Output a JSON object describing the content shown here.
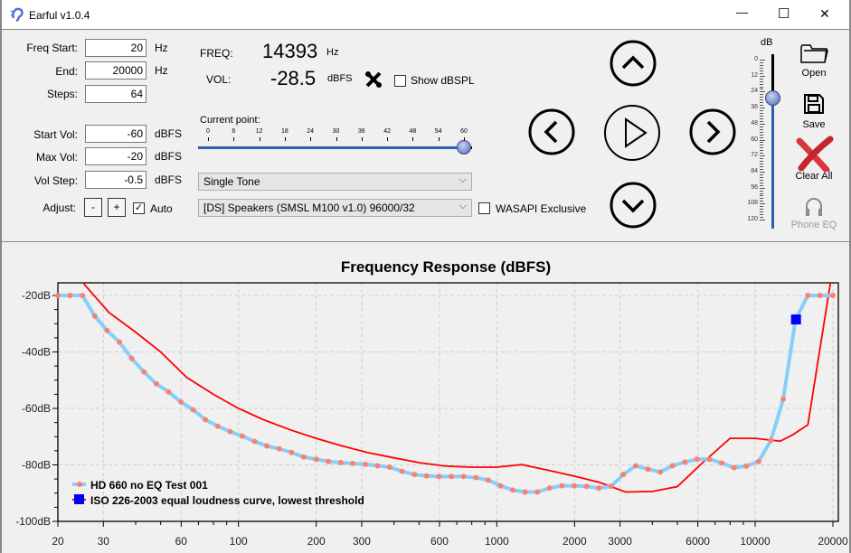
{
  "window": {
    "title": "Earful v1.0.4",
    "icon": "ear-icon",
    "minimize": "—",
    "maximize": "☐",
    "close": "✕"
  },
  "settings": {
    "freq_start": {
      "label": "Freq Start:",
      "value": "20",
      "unit": "Hz"
    },
    "end": {
      "label": "End:",
      "value": "20000",
      "unit": "Hz"
    },
    "steps": {
      "label": "Steps:",
      "value": "64"
    },
    "start_vol": {
      "label": "Start Vol:",
      "value": "-60",
      "unit": "dBFS"
    },
    "max_vol": {
      "label": "Max Vol:",
      "value": "-20",
      "unit": "dBFS"
    },
    "vol_step": {
      "label": "Vol Step:",
      "value": "-0.5",
      "unit": "dBFS"
    },
    "adjust": {
      "label": "Adjust:",
      "minus": "-",
      "plus": "+",
      "auto_label": "Auto",
      "auto_checked": true
    }
  },
  "readout": {
    "freq_label": "FREQ:",
    "freq_value": "14393",
    "freq_unit": "Hz",
    "vol_label": "VOL:",
    "vol_value": "-28.5",
    "vol_unit": "dBFS",
    "show_dbspl_label": "Show dBSPL",
    "show_dbspl_checked": false
  },
  "current_point": {
    "label": "Current point:",
    "ticks": [
      "0",
      "6",
      "12",
      "18",
      "24",
      "30",
      "36",
      "42",
      "48",
      "54",
      "60"
    ],
    "value": 60,
    "max": 63
  },
  "tone_select": {
    "value": "Single Tone"
  },
  "device_select": {
    "value": "[DS] Speakers (SMSL M100 v1.0) 96000/32"
  },
  "wasapi": {
    "label": "WASAPI Exclusive",
    "checked": false
  },
  "volume_slider": {
    "label": "dB",
    "ticks": [
      "0",
      "12",
      "24",
      "36",
      "48",
      "60",
      "72",
      "84",
      "96",
      "108",
      "120"
    ],
    "value": 28.5
  },
  "side_buttons": {
    "open": "Open",
    "save": "Save",
    "clear_all": "Clear All",
    "phone_eq": "Phone EQ"
  },
  "colors": {
    "measured_line": "#87cefa",
    "measured_points": "#fa8072",
    "iso_line": "#ff0000",
    "current_marker": "#0000ff",
    "slider_blue": "#2d5fb5"
  },
  "chart_data": {
    "type": "line",
    "title": "Frequency Response (dBFS)",
    "x_scale": "log",
    "xlim": [
      20,
      20000
    ],
    "ylim": [
      -100,
      -15.5
    ],
    "grid": true,
    "x_ticks": [
      "20",
      "30",
      "60",
      "100",
      "200",
      "300",
      "600",
      "1000",
      "2000",
      "3000",
      "6000",
      "10000",
      "20000"
    ],
    "y_ticks": [
      "-20dB",
      "-40dB",
      "-60dB",
      "-80dB",
      "-100dB"
    ],
    "legend_position": "bottom-left",
    "series": [
      {
        "name": "HD 660 no EQ Test 001",
        "x": [
          20,
          22.3,
          24.9,
          27.8,
          31,
          34.6,
          38.6,
          43.1,
          48.1,
          53.6,
          59.9,
          66.8,
          74.5,
          83.2,
          92.8,
          103.5,
          115.5,
          128.9,
          143.8,
          160.5,
          179,
          200,
          223,
          249,
          277,
          310,
          345,
          385,
          430,
          480,
          535,
          597,
          667,
          744,
          830,
          926,
          1033,
          1153,
          1286,
          1435,
          1601,
          1787,
          1994,
          2225,
          2482,
          2770,
          3090,
          3448,
          3848,
          4293,
          4790,
          5345,
          5964,
          6654,
          7425,
          8285,
          9244,
          10315,
          11509,
          12842,
          14329,
          15989,
          17840,
          20000
        ],
        "y": [
          -20,
          -20,
          -20,
          -27.3,
          -32.4,
          -36.5,
          -42.3,
          -47.1,
          -51.3,
          -54.1,
          -57.7,
          -60.5,
          -64,
          -66.3,
          -68.2,
          -69.8,
          -71.7,
          -73.3,
          -74.3,
          -75.6,
          -77.2,
          -78,
          -78.8,
          -79.2,
          -79.5,
          -79.8,
          -80.3,
          -80.8,
          -82.3,
          -83.4,
          -83.9,
          -84.1,
          -84.1,
          -84.1,
          -84.5,
          -85.4,
          -87.4,
          -88.9,
          -89.6,
          -89.6,
          -88.2,
          -87.4,
          -87.4,
          -87.6,
          -88.2,
          -87.6,
          -83.4,
          -80.3,
          -81.5,
          -82.5,
          -80.3,
          -79,
          -78,
          -78,
          -79.3,
          -81,
          -80.4,
          -78.8,
          -71.3,
          -56.7,
          -28.6,
          -20,
          -20,
          -20
        ]
      },
      {
        "name": "ISO 226-2003 equal loudness curve, lowest threshold",
        "x": [
          20,
          25,
          31.5,
          40,
          50,
          63,
          80,
          100,
          125,
          160,
          200,
          250,
          315,
          400,
          500,
          630,
          800,
          1000,
          1250,
          1600,
          2000,
          2500,
          3150,
          4000,
          5000,
          6300,
          8000,
          10000,
          12500,
          14000,
          16000,
          20000
        ],
        "y": [
          -6,
          -15.5,
          -26,
          -33,
          -40,
          -49,
          -55,
          -60,
          -64,
          -67.7,
          -70.6,
          -73.2,
          -75.6,
          -77.5,
          -79.2,
          -80.4,
          -80.8,
          -80.8,
          -79.9,
          -82,
          -84,
          -86.2,
          -89.6,
          -89.4,
          -87.7,
          -79,
          -70.6,
          -70.6,
          -71.6,
          -69.3,
          -65.8,
          -10
        ]
      }
    ],
    "current_point": {
      "x": 14393,
      "y": -28.5
    }
  }
}
